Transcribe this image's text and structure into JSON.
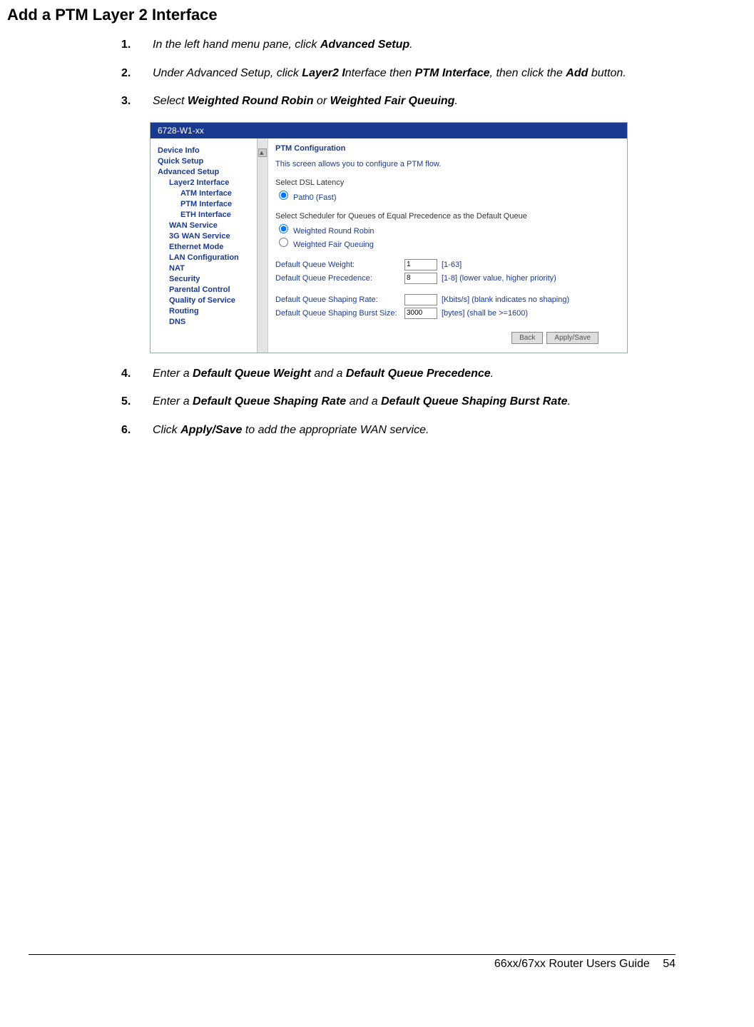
{
  "heading": "Add a PTM Layer 2 Interface",
  "steps": {
    "s1": {
      "n": "1.",
      "pre": "In the left hand menu pane, click ",
      "bold1": "Advanced Setup",
      "post": "."
    },
    "s2": {
      "n": "2.",
      "pre": "Under Advanced Setup, click ",
      "bold1": "Layer2 I",
      "mid1": "nterface then ",
      "bold2": "PTM Interface",
      "mid2": ", then click the ",
      "bold3": "Add",
      "post": " button."
    },
    "s3": {
      "n": "3.",
      "pre": "Select ",
      "bold1": "Weighted Round Robin",
      "mid1": " or ",
      "bold2": "Weighted Fair Queuing",
      "post": "."
    },
    "s4": {
      "n": "4.",
      "pre": "Enter a ",
      "bold1": "Default Queue Weight",
      "mid1": " and a ",
      "bold2": "Default Queue Precedence",
      "post": "."
    },
    "s5": {
      "n": "5.",
      "pre": "Enter a ",
      "bold1": "Default Queue Shaping Rate",
      "mid1": " and a ",
      "bold2": "Default Queue Shaping Burst Rate",
      "post": "."
    },
    "s6": {
      "n": "6.",
      "pre": "Click ",
      "bold1": "Apply/Save",
      "post": " to add the appropriate WAN service."
    }
  },
  "router": {
    "title": "6728-W1-xx",
    "nav": [
      {
        "label": "Device Info",
        "cls": "nav-item"
      },
      {
        "label": "Quick Setup",
        "cls": "nav-item"
      },
      {
        "label": "Advanced Setup",
        "cls": "nav-item"
      },
      {
        "label": "Layer2 Interface",
        "cls": "nav-item nav-sub"
      },
      {
        "label": "ATM Interface",
        "cls": "nav-item nav-sub2"
      },
      {
        "label": "PTM Interface",
        "cls": "nav-item nav-sub2"
      },
      {
        "label": "ETH Interface",
        "cls": "nav-item nav-sub2"
      },
      {
        "label": "WAN Service",
        "cls": "nav-item nav-sub"
      },
      {
        "label": "3G WAN Service",
        "cls": "nav-item nav-sub"
      },
      {
        "label": "Ethernet Mode",
        "cls": "nav-item nav-sub"
      },
      {
        "label": "LAN Configuration",
        "cls": "nav-item nav-sub"
      },
      {
        "label": "NAT",
        "cls": "nav-item nav-sub"
      },
      {
        "label": "Security",
        "cls": "nav-item nav-sub"
      },
      {
        "label": "Parental Control",
        "cls": "nav-item nav-sub"
      },
      {
        "label": "Quality of Service",
        "cls": "nav-item nav-sub"
      },
      {
        "label": "Routing",
        "cls": "nav-item nav-sub"
      },
      {
        "label": "DNS",
        "cls": "nav-item nav-sub"
      }
    ],
    "main": {
      "hdr": "PTM Configuration",
      "intro": "This screen allows you to configure a PTM flow.",
      "latency_label": "Select DSL Latency",
      "latency_opt": "Path0 (Fast)",
      "sched_label": "Select Scheduler for Queues of Equal Precedence as the Default Queue",
      "sched_opt1": "Weighted Round Robin",
      "sched_opt2": "Weighted Fair Queuing",
      "qw_label": "Default Queue Weight:",
      "qw_val": "1",
      "qw_hint": "[1-63]",
      "qp_label": "Default Queue Precedence:",
      "qp_val": "8",
      "qp_hint": "[1-8] (lower value, higher priority)",
      "sr_label": "Default Queue Shaping Rate:",
      "sr_val": "",
      "sr_hint": "[Kbits/s] (blank indicates no shaping)",
      "sb_label": "Default Queue Shaping Burst Size:",
      "sb_val": "3000",
      "sb_hint": "[bytes] (shall be >=1600)",
      "btn_back": "Back",
      "btn_apply": "Apply/Save"
    }
  },
  "footer": {
    "guide": "66xx/67xx Router Users Guide",
    "page": "54"
  }
}
